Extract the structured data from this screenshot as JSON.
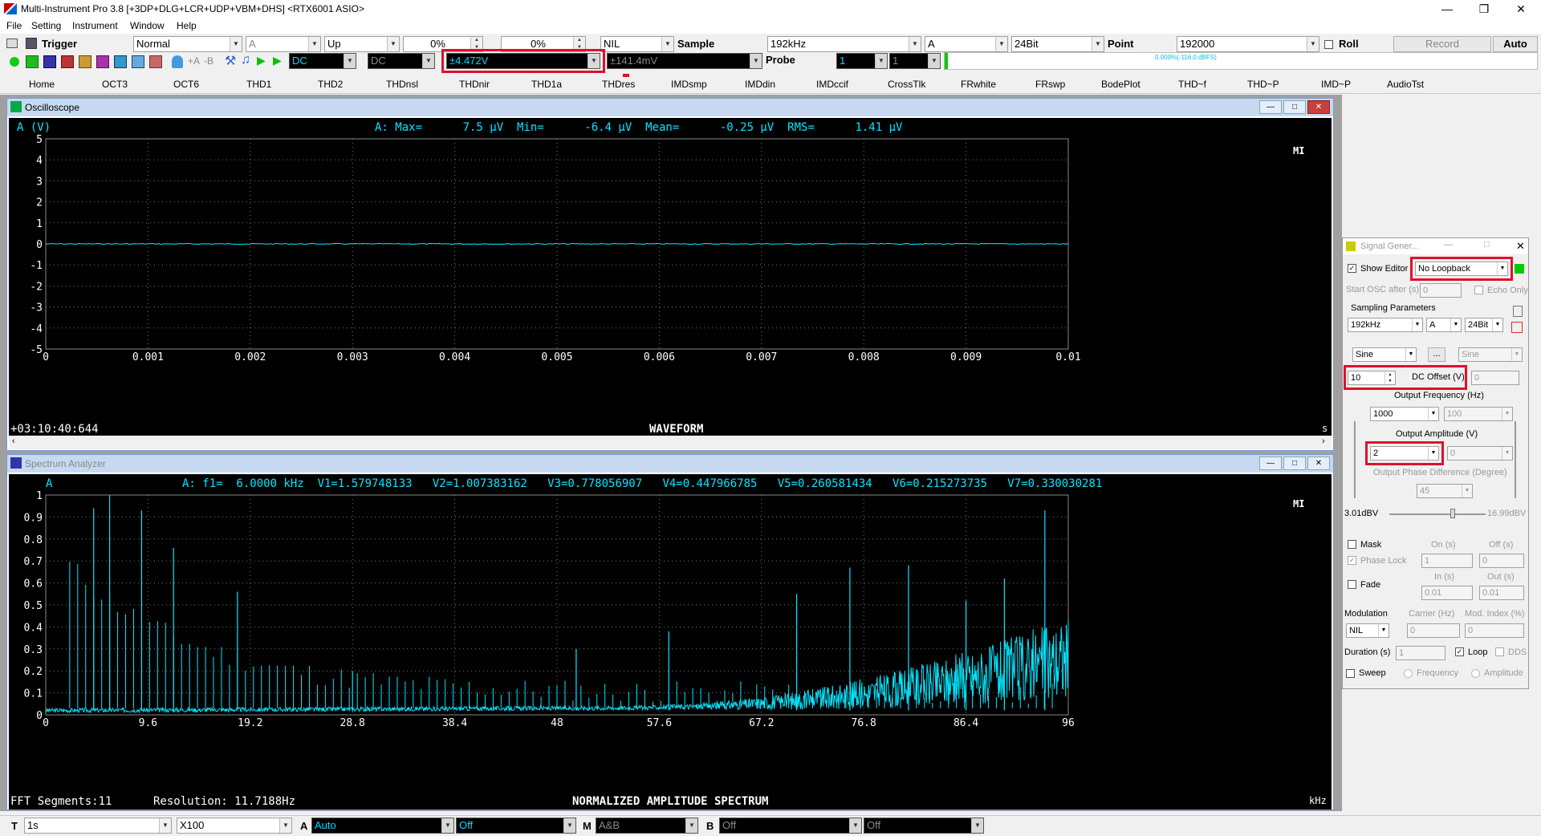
{
  "titlebar": {
    "title": "Multi-Instrument Pro 3.8    [+3DP+DLG+LCR+UDP+VBM+DHS]    <RTX6001 ASIO>"
  },
  "menu": [
    "File",
    "Setting",
    "Instrument",
    "Window",
    "Help"
  ],
  "toolbar1": {
    "trigger_label": "Trigger",
    "trigger_mode": "Normal",
    "trigger_channel": "A",
    "trigger_edge": "Up",
    "trigger_level": "0%",
    "trigger_delay": "0%",
    "window_func": "NIL",
    "sample_label": "Sample",
    "sample_rate": "192kHz",
    "channel": "A",
    "bit_depth": "24Bit",
    "point_label": "Point",
    "points": "192000",
    "roll_label": "Roll",
    "record_label": "Record",
    "auto_label": "Auto"
  },
  "toolbar2": {
    "coupling_a": "DC",
    "coupling_b": "DC",
    "range_a": "±4.472V",
    "range_b": "±141.4mV",
    "probe_label": "Probe",
    "probe_a": "1",
    "probe_b": "1",
    "level_readout": "0.000%(-116.0 dBFS)"
  },
  "tabs": [
    "Home",
    "OCT3",
    "OCT6",
    "THD1",
    "THD2",
    "THDnsl",
    "THDnir",
    "THD1a",
    "THDres",
    "IMDsmp",
    "IMDdin",
    "IMDccif",
    "CrossTlk",
    "FRwhite",
    "FRswp",
    "BodePlot",
    "THD~f",
    "THD~P",
    "IMD~P",
    "AudioTst"
  ],
  "oscilloscope": {
    "title": "Oscilloscope",
    "channel_label": "A  (V)",
    "stats": "A: Max=      7.5 μV  Min=      -6.4 μV  Mean=      -0.25 μV  RMS=      1.41 μV",
    "brand": "MI",
    "timestamp": "+03:10:40:644",
    "mode_label": "WAVEFORM",
    "x_unit": "s"
  },
  "spectrum": {
    "title": "Spectrum Analyzer",
    "channel_label": "A",
    "stats": "A: f1=  6.0000 kHz  V1=1.579748133   V2=1.007383162   V3=0.778056907   V4=0.447966785   V5=0.260581434   V6=0.215273735   V7=0.330030281",
    "brand": "MI",
    "fft_segments": "FFT Segments:11",
    "resolution": "Resolution: 11.7188Hz",
    "mode_label": "NORMALIZED AMPLITUDE SPECTRUM",
    "x_unit": "kHz"
  },
  "chart_data": [
    {
      "type": "line",
      "title": "",
      "xlabel": "WAVEFORM",
      "ylabel": "A (V)",
      "xlim": [
        0,
        0.01
      ],
      "ylim": [
        -5,
        5
      ],
      "x_ticks": [
        "0",
        "0.001",
        "0.002",
        "0.003",
        "0.004",
        "0.005",
        "0.006",
        "0.007",
        "0.008",
        "0.009",
        "0.01"
      ],
      "y_ticks": [
        "5",
        "4",
        "3",
        "2",
        "1",
        "0",
        "-1",
        "-2",
        "-3",
        "-4",
        "-5"
      ],
      "grid": true,
      "series": [
        {
          "x": [
            0,
            0.01
          ],
          "values": [
            0,
            0
          ]
        }
      ]
    },
    {
      "type": "line",
      "title": "",
      "xlabel": "NORMALIZED AMPLITUDE SPECTRUM",
      "ylabel": "",
      "xlim": [
        0,
        96
      ],
      "ylim": [
        0,
        1
      ],
      "x_ticks": [
        "0",
        "9.6",
        "19.2",
        "28.8",
        "38.4",
        "48",
        "57.6",
        "67.2",
        "76.8",
        "86.4",
        "96"
      ],
      "y_ticks": [
        "1",
        "0.9",
        "0.8",
        "0.7",
        "0.6",
        "0.5",
        "0.4",
        "0.3",
        "0.2",
        "0.1",
        "0"
      ],
      "grid": true,
      "peaks_x_khz": [
        4.5,
        6.0,
        9.0,
        12.0,
        18.0,
        28.8,
        49.8,
        58.5,
        70.5,
        75.5,
        81.0,
        86.4,
        90.0,
        93.8
      ],
      "peaks_y": [
        0.94,
        1.0,
        0.93,
        0.76,
        0.56,
        0.2,
        0.3,
        0.38,
        0.55,
        0.67,
        0.68,
        0.52,
        0.62,
        0.93
      ]
    }
  ],
  "signal_generator": {
    "title": "Signal Gener...",
    "show_editor_label": "Show Editor",
    "loopback": "No Loopback",
    "start_osc_label": "Start OSC after (s)",
    "start_osc_value": "0",
    "echo_only_label": "Echo Only",
    "sampling_label": "Sampling Parameters",
    "sample_rate": "192kHz",
    "channel": "A",
    "bit_depth": "24Bit",
    "waveform_a": "Sine",
    "waveform_b": "Sine",
    "more_label": "...",
    "dc_offset_value": "10",
    "dc_offset_label": "DC Offset (V)",
    "dc_offset_b": "0",
    "freq_label": "Output Frequency (Hz)",
    "freq_a": "1000",
    "freq_b": "100",
    "amp_label": "Output Amplitude (V)",
    "amp_a": "2",
    "amp_b": "0",
    "phase_label": "Output Phase Difference (Degree)",
    "phase_value": "45",
    "level_left": "3.01dBV",
    "level_right": "16.99dBV",
    "mask_label": "Mask",
    "on_label": "On (s)",
    "off_label": "Off (s)",
    "phase_lock_label": "Phase Lock",
    "on_value": "1",
    "off_value": "0",
    "fade_label": "Fade",
    "in_label": "In (s)",
    "out_label": "Out (s)",
    "in_value": "0.01",
    "out_value": "0.01",
    "modulation_label": "Modulation",
    "carrier_label": "Carrier (Hz)",
    "mod_index_label": "Mod. Index (%)",
    "modulation_value": "NIL",
    "carrier_value": "0",
    "mod_index_value": "0",
    "duration_label": "Duration (s)",
    "duration_value": "1",
    "loop_label": "Loop",
    "dds_label": "DDS",
    "sweep_label": "Sweep",
    "frequency_label": "Frequency",
    "amplitude_label": "Amplitude"
  },
  "statusbar": {
    "t_label": "T",
    "time_value": "1s",
    "multiplier": "X100",
    "a_label": "A",
    "a_mode": "Auto",
    "a_value": "Off",
    "m_label": "M",
    "m_value": "A&B",
    "b_label": "B",
    "b_mode": "Off",
    "b_value": "Off"
  }
}
